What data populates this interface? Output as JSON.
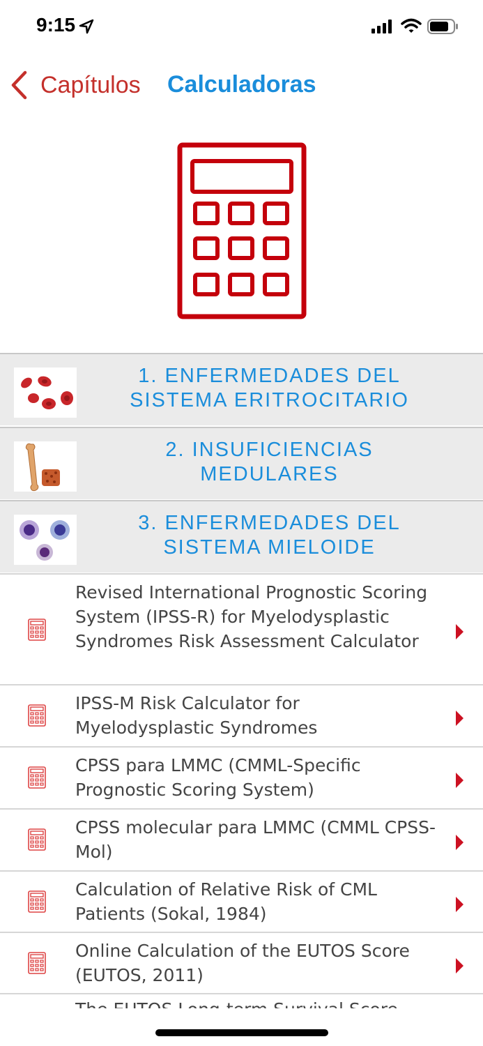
{
  "status_bar": {
    "time": "9:15"
  },
  "nav": {
    "back_label": "Capítulos",
    "title": "Calculadoras"
  },
  "colors": {
    "accent_red": "#c4302b",
    "accent_blue": "#1a8ddb",
    "section_bg": "#ebebeb",
    "row_text": "#444444"
  },
  "sections": [
    {
      "title": "1. ENFERMEDADES DEL\nSISTEMA ERITROCITARIO",
      "thumb_icon": "red-blood-cells-icon"
    },
    {
      "title": "2. INSUFICIENCIAS\nMEDULARES",
      "thumb_icon": "bone-marrow-icon"
    },
    {
      "title": "3. ENFERMEDADES DEL\nSISTEMA MIELOIDE",
      "thumb_icon": "myeloid-cells-icon"
    }
  ],
  "rows": [
    {
      "label": "Revised International Prognostic Scoring System (IPSS-R) for Myelodysplastic Syndromes Risk Assessment Calculator"
    },
    {
      "label": "IPSS-M Risk Calculator for Myelodysplastic Syndromes"
    },
    {
      "label": "CPSS para LMMC (CMML-Specific Prognostic Scoring System)"
    },
    {
      "label": "CPSS molecular para LMMC (CMML CPSS-Mol)"
    },
    {
      "label": "Calculation of Relative Risk of CML Patients (Sokal, 1984)"
    },
    {
      "label": "Online Calculation of the EUTOS Score (EUTOS, 2011)"
    }
  ],
  "cutoff_row": {
    "label": "The EUTOS Long-term Survival Score"
  }
}
